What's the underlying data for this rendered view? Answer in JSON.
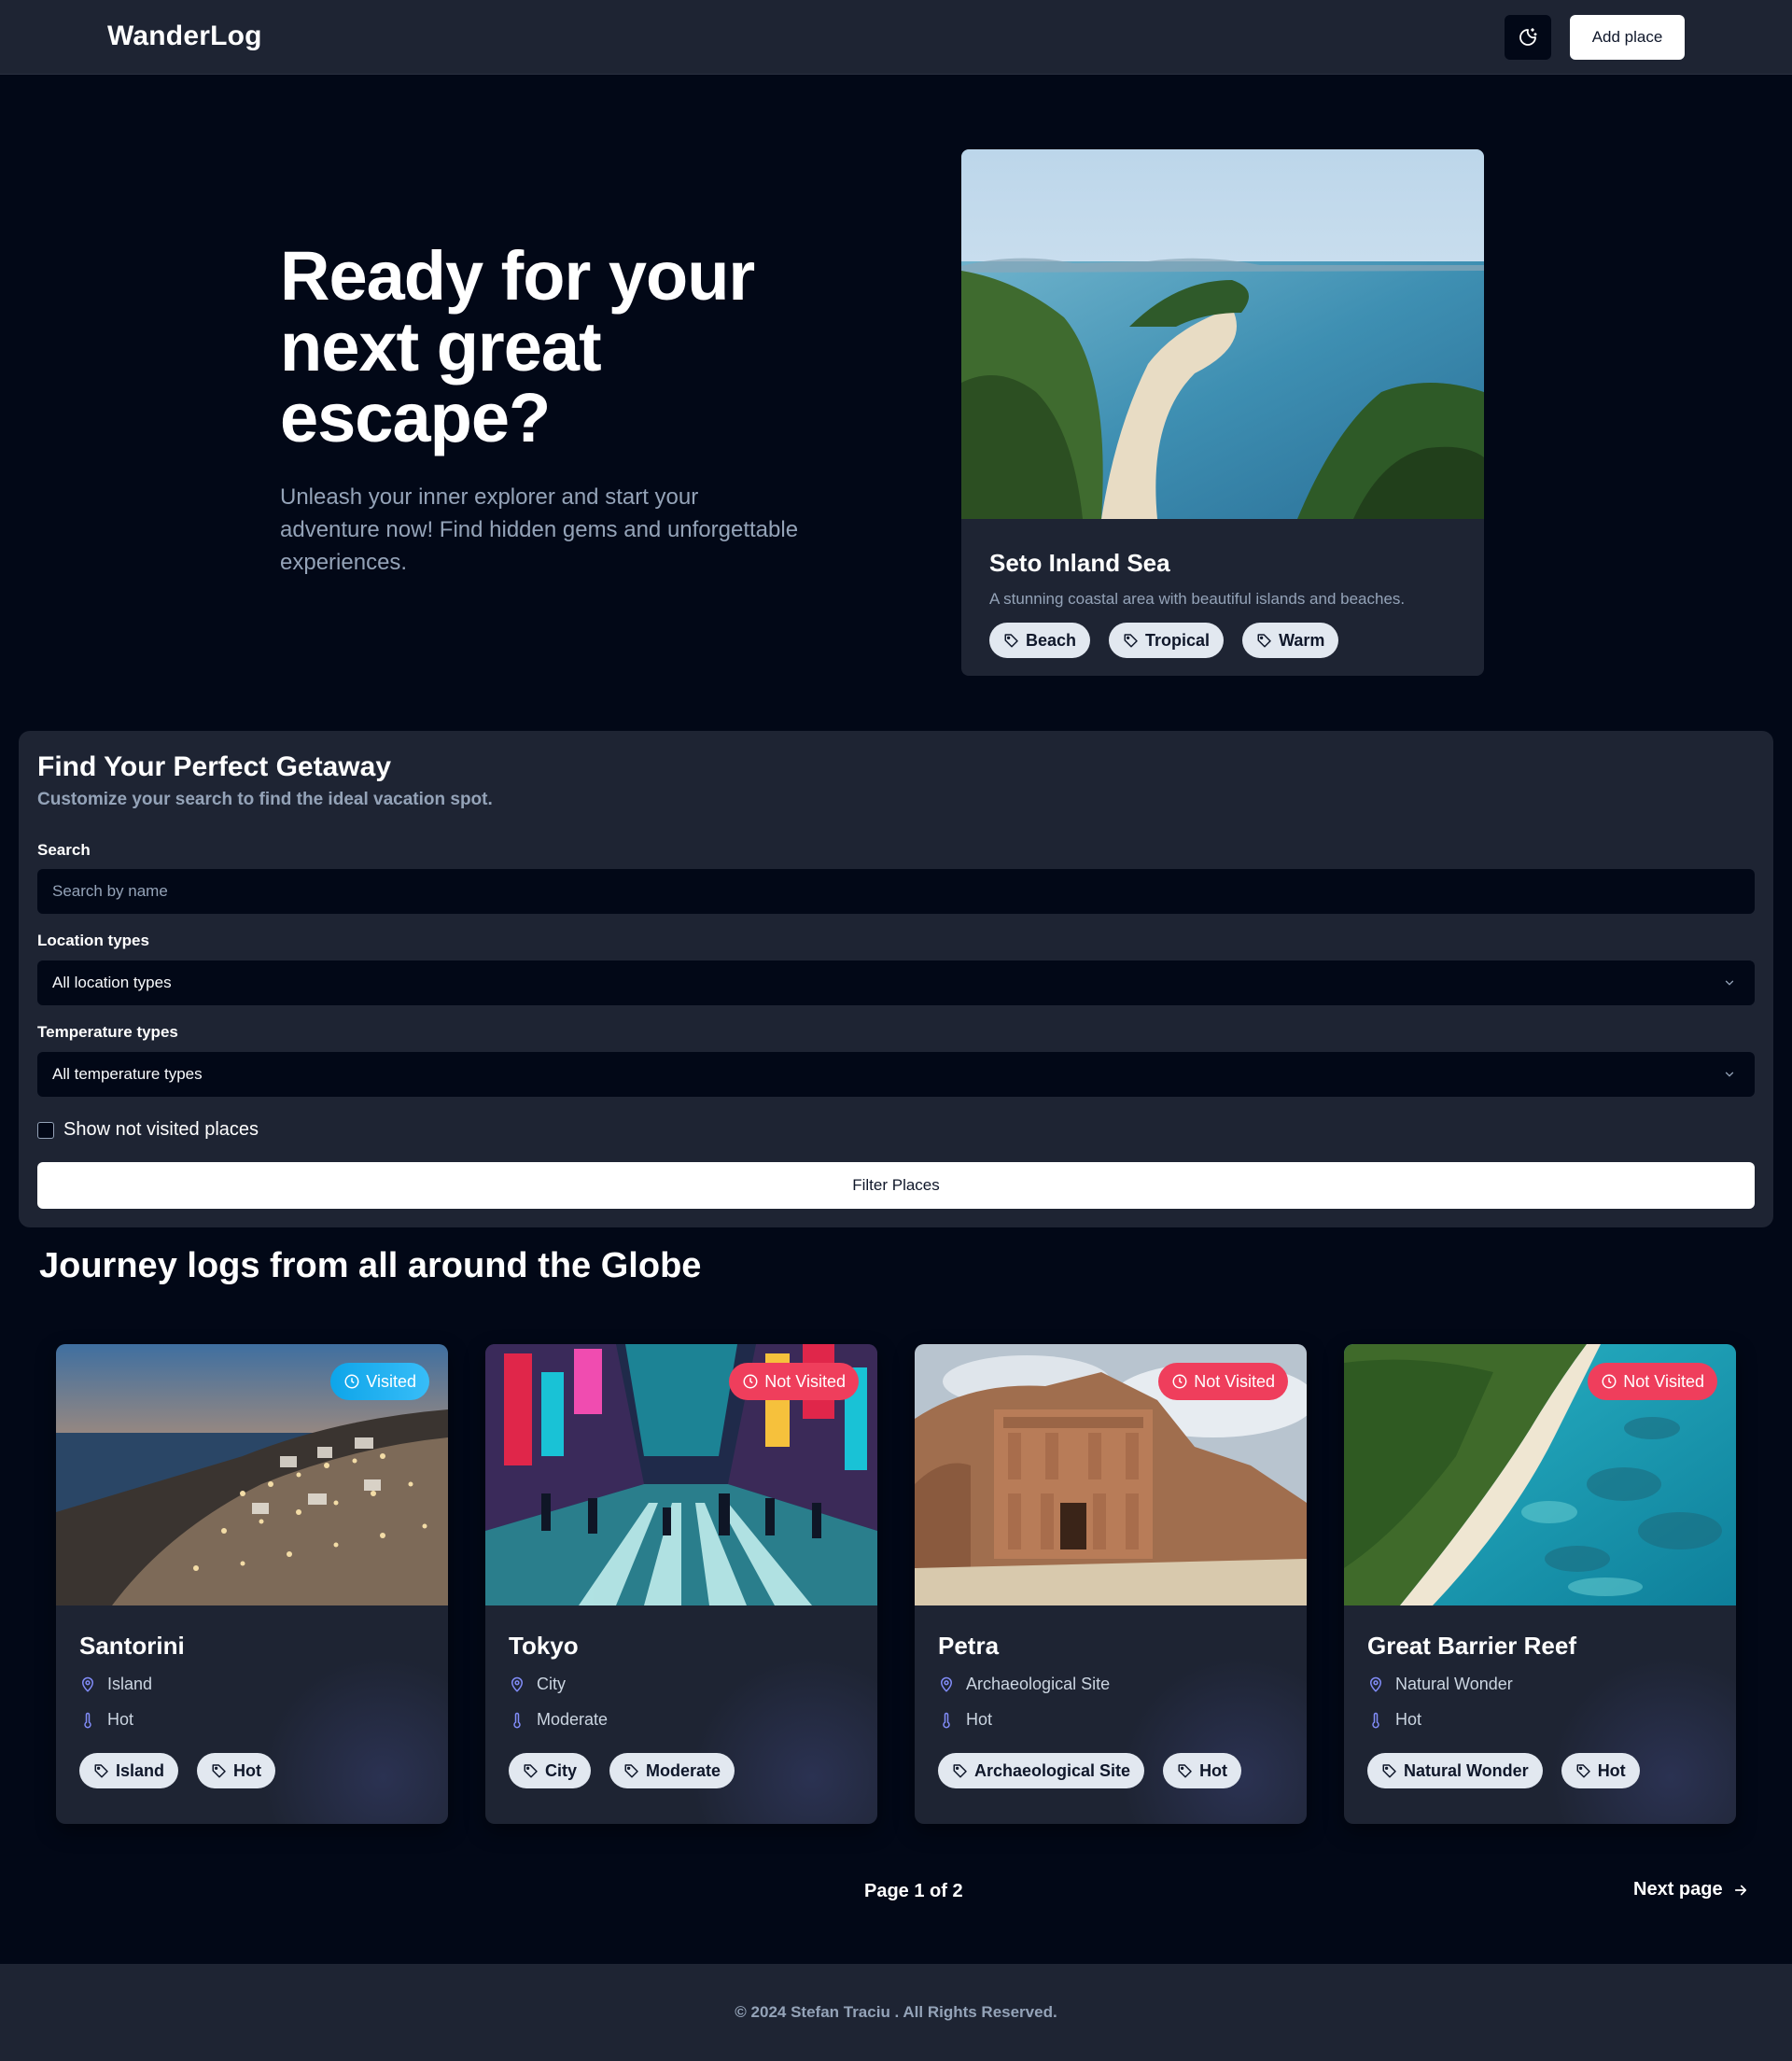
{
  "header": {
    "logo": "WanderLog",
    "theme_icon": "moon-stars-icon",
    "add_place_label": "Add place"
  },
  "hero": {
    "title": "Ready for your next great escape?",
    "subtitle": "Unleash your inner explorer and start your adventure now! Find hidden gems and unforgettable experiences.",
    "featured": {
      "title": "Seto Inland Sea",
      "description": "A stunning coastal area with beautiful islands and beaches.",
      "tags": [
        "Beach",
        "Tropical",
        "Warm"
      ]
    }
  },
  "filter": {
    "title": "Find Your Perfect Getaway",
    "subtitle": "Customize your search to find the ideal vacation spot.",
    "search_label": "Search",
    "search_placeholder": "Search by name",
    "location_label": "Location types",
    "location_value": "All location types",
    "temperature_label": "Temperature types",
    "temperature_value": "All temperature types",
    "checkbox_label": "Show not visited places",
    "checkbox_checked": false,
    "button_label": "Filter Places"
  },
  "journeys": {
    "title": "Journey logs from all around the Globe",
    "cards": [
      {
        "title": "Santorini",
        "status": "Visited",
        "location": "Island",
        "temperature": "Hot",
        "tags": [
          "Island",
          "Hot"
        ]
      },
      {
        "title": "Tokyo",
        "status": "Not Visited",
        "location": "City",
        "temperature": "Moderate",
        "tags": [
          "City",
          "Moderate"
        ]
      },
      {
        "title": "Petra",
        "status": "Not Visited",
        "location": "Archaeological Site",
        "temperature": "Hot",
        "tags": [
          "Archaeological Site",
          "Hot"
        ]
      },
      {
        "title": "Great Barrier Reef",
        "status": "Not Visited",
        "location": "Natural Wonder",
        "temperature": "Hot",
        "tags": [
          "Natural Wonder",
          "Hot"
        ]
      }
    ]
  },
  "pagination": {
    "page_info": "Page 1 of 2",
    "next_label": "Next page"
  },
  "footer": {
    "text": "© 2024 Stefan Traciu . All Rights Reserved."
  },
  "colors": {
    "background": "#020817",
    "panel": "#1e2433",
    "muted_text": "#94a3b8",
    "visited_badge": "#0ea5e9",
    "not_visited_badge": "#ef3e5c",
    "icon_accent": "#818cf8"
  }
}
